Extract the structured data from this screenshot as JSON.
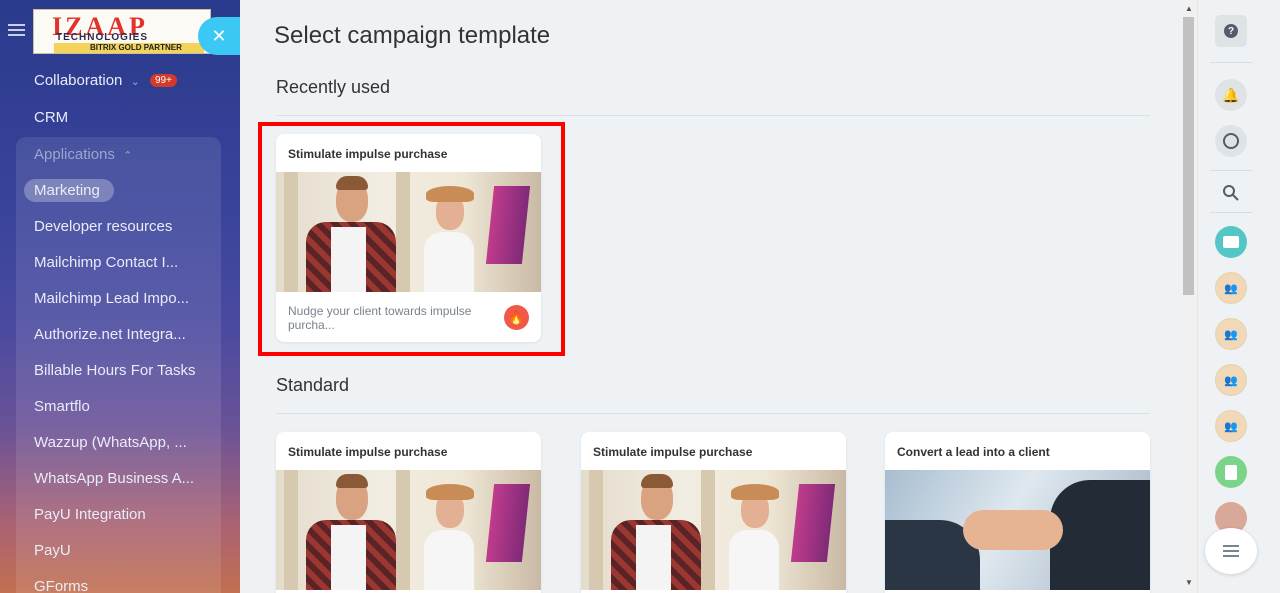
{
  "sidebar": {
    "logo": {
      "brand": "IZAAP",
      "line2": "TECHNOLOGIES",
      "tagline": "BITRIX GOLD PARTNER"
    },
    "items": [
      {
        "label": "Collaboration",
        "badge": "99+"
      },
      {
        "label": "CRM"
      },
      {
        "label": "Applications"
      },
      {
        "label": "Marketing"
      },
      {
        "label": "Developer resources"
      },
      {
        "label": "Mailchimp Contact I..."
      },
      {
        "label": "Mailchimp Lead Impo..."
      },
      {
        "label": "Authorize.net Integra..."
      },
      {
        "label": "Billable Hours For Tasks"
      },
      {
        "label": "Smartflo"
      },
      {
        "label": "Wazzup (WhatsApp, ..."
      },
      {
        "label": "WhatsApp Business A..."
      },
      {
        "label": "PayU Integration"
      },
      {
        "label": "PayU"
      },
      {
        "label": "GForms"
      }
    ]
  },
  "main": {
    "title": "Select campaign template",
    "recent": {
      "heading": "Recently used",
      "card": {
        "title": "Stimulate impulse purchase",
        "desc": "Nudge your client towards impulse purcha..."
      }
    },
    "standard": {
      "heading": "Standard",
      "cards": [
        {
          "title": "Stimulate impulse purchase"
        },
        {
          "title": "Stimulate impulse purchase"
        },
        {
          "title": "Convert a lead into a client"
        }
      ]
    }
  },
  "colors": {
    "accent": "#3bc8f5",
    "highlight": "#ff0000",
    "badge": "#d23a2c",
    "fire": "#f1584a"
  }
}
